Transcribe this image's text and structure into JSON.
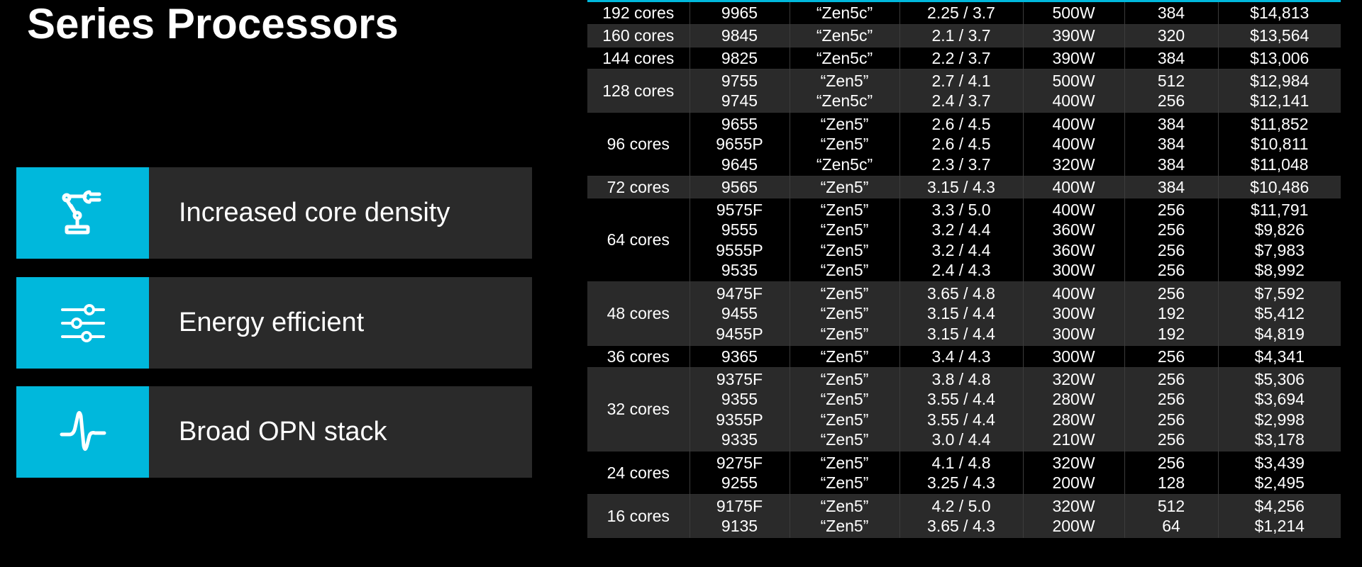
{
  "title": "Series Processors",
  "features": [
    {
      "icon": "robot-arm-icon",
      "label": "Increased core density"
    },
    {
      "icon": "sliders-icon",
      "label": "Energy efficient"
    },
    {
      "icon": "pulse-icon",
      "label": "Broad OPN stack"
    }
  ],
  "colors": {
    "accent": "#00b8dc",
    "panel": "#2a2a2a",
    "background": "#000000"
  },
  "table": {
    "rows": [
      {
        "cores": "192 cores",
        "models": [
          "9965"
        ],
        "arch": [
          "“Zen5c”"
        ],
        "freq": [
          "2.25 / 3.7"
        ],
        "tdp": [
          "500W"
        ],
        "cache": [
          "384"
        ],
        "price": [
          "$14,813"
        ]
      },
      {
        "cores": "160 cores",
        "models": [
          "9845"
        ],
        "arch": [
          "“Zen5c”"
        ],
        "freq": [
          "2.1 / 3.7"
        ],
        "tdp": [
          "390W"
        ],
        "cache": [
          "320"
        ],
        "price": [
          "$13,564"
        ]
      },
      {
        "cores": "144 cores",
        "models": [
          "9825"
        ],
        "arch": [
          "“Zen5c”"
        ],
        "freq": [
          "2.2 / 3.7"
        ],
        "tdp": [
          "390W"
        ],
        "cache": [
          "384"
        ],
        "price": [
          "$13,006"
        ]
      },
      {
        "cores": "128 cores",
        "models": [
          "9755",
          "9745"
        ],
        "arch": [
          "“Zen5”",
          "“Zen5c”"
        ],
        "freq": [
          "2.7 / 4.1",
          "2.4 / 3.7"
        ],
        "tdp": [
          "500W",
          "400W"
        ],
        "cache": [
          "512",
          "256"
        ],
        "price": [
          "$12,984",
          "$12,141"
        ]
      },
      {
        "cores": "96 cores",
        "models": [
          "9655",
          "9655P",
          "9645"
        ],
        "arch": [
          "“Zen5”",
          "“Zen5”",
          "“Zen5c”"
        ],
        "freq": [
          "2.6 / 4.5",
          "2.6 / 4.5",
          "2.3 / 3.7"
        ],
        "tdp": [
          "400W",
          "400W",
          "320W"
        ],
        "cache": [
          "384",
          "384",
          "384"
        ],
        "price": [
          "$11,852",
          "$10,811",
          "$11,048"
        ]
      },
      {
        "cores": "72 cores",
        "models": [
          "9565"
        ],
        "arch": [
          "“Zen5”"
        ],
        "freq": [
          "3.15 / 4.3"
        ],
        "tdp": [
          "400W"
        ],
        "cache": [
          "384"
        ],
        "price": [
          "$10,486"
        ]
      },
      {
        "cores": "64 cores",
        "models": [
          "9575F",
          "9555",
          "9555P",
          "9535"
        ],
        "arch": [
          "“Zen5”",
          "“Zen5”",
          "“Zen5”",
          "“Zen5”"
        ],
        "freq": [
          "3.3 / 5.0",
          "3.2 / 4.4",
          "3.2 / 4.4",
          "2.4 / 4.3"
        ],
        "tdp": [
          "400W",
          "360W",
          "360W",
          "300W"
        ],
        "cache": [
          "256",
          "256",
          "256",
          "256"
        ],
        "price": [
          "$11,791",
          "$9,826",
          "$7,983",
          "$8,992"
        ]
      },
      {
        "cores": "48 cores",
        "models": [
          "9475F",
          "9455",
          "9455P"
        ],
        "arch": [
          "“Zen5”",
          "“Zen5”",
          "“Zen5”"
        ],
        "freq": [
          "3.65 / 4.8",
          "3.15 / 4.4",
          "3.15 / 4.4"
        ],
        "tdp": [
          "400W",
          "300W",
          "300W"
        ],
        "cache": [
          "256",
          "192",
          "192"
        ],
        "price": [
          "$7,592",
          "$5,412",
          "$4,819"
        ]
      },
      {
        "cores": "36 cores",
        "models": [
          "9365"
        ],
        "arch": [
          "“Zen5”"
        ],
        "freq": [
          "3.4 / 4.3"
        ],
        "tdp": [
          "300W"
        ],
        "cache": [
          "256"
        ],
        "price": [
          "$4,341"
        ]
      },
      {
        "cores": "32 cores",
        "models": [
          "9375F",
          "9355",
          "9355P",
          "9335"
        ],
        "arch": [
          "“Zen5”",
          "“Zen5”",
          "“Zen5”",
          "“Zen5”"
        ],
        "freq": [
          "3.8 / 4.8",
          "3.55 / 4.4",
          "3.55 / 4.4",
          "3.0 / 4.4"
        ],
        "tdp": [
          "320W",
          "280W",
          "280W",
          "210W"
        ],
        "cache": [
          "256",
          "256",
          "256",
          "256"
        ],
        "price": [
          "$5,306",
          "$3,694",
          "$2,998",
          "$3,178"
        ]
      },
      {
        "cores": "24 cores",
        "models": [
          "9275F",
          "9255"
        ],
        "arch": [
          "“Zen5”",
          "“Zen5”"
        ],
        "freq": [
          "4.1 / 4.8",
          "3.25 / 4.3"
        ],
        "tdp": [
          "320W",
          "200W"
        ],
        "cache": [
          "256",
          "128"
        ],
        "price": [
          "$3,439",
          "$2,495"
        ]
      },
      {
        "cores": "16 cores",
        "models": [
          "9175F",
          "9135"
        ],
        "arch": [
          "“Zen5”",
          "“Zen5”"
        ],
        "freq": [
          "4.2 / 5.0",
          "3.65 / 4.3"
        ],
        "tdp": [
          "320W",
          "200W"
        ],
        "cache": [
          "512",
          "64"
        ],
        "price": [
          "$4,256",
          "$1,214"
        ]
      }
    ]
  }
}
